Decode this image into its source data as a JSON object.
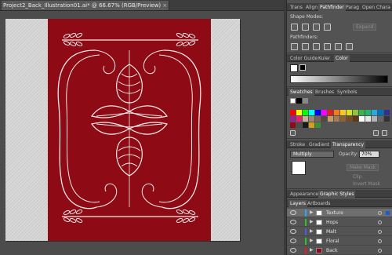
{
  "document": {
    "tab_title": "Project2_Back_Illustration01.ai* @ 66.67% (RGB/Preview)",
    "close_glyph": "×"
  },
  "colors": {
    "red_panel": "#8e0a14",
    "ornament": "#f4e9e9",
    "layer_colors": [
      "#29a8ff",
      "#2fbf2f",
      "#5a55e6",
      "#26c726",
      "#e02020"
    ]
  },
  "dock": {
    "top_tabs": [
      "Trans",
      "Align",
      "Pathfinder",
      "Parag",
      "Open",
      "Chara"
    ],
    "shape_modes_label": "Shape Modes:",
    "expand_label": "Expand",
    "pathfinders_label": "Pathfinders:",
    "color_tabs": [
      "Color Guide",
      "Kuler",
      "Color"
    ],
    "swatch_tabs": [
      "Swatches",
      "Brushes",
      "Symbols"
    ],
    "stroke_tabs": [
      "Stroke",
      "Gradient",
      "Transparency"
    ],
    "blend_mode": "Multiply",
    "opacity_label": "Opacity:",
    "opacity_value": "70%",
    "make_mask_label": "Make Mask",
    "clip_label": "Clip",
    "invert_mask_label": "Invert Mask",
    "appearance_tabs": [
      "Appearance",
      "Graphic Styles"
    ],
    "layers_tabs": [
      "Layers",
      "Artboards"
    ]
  },
  "layers": [
    {
      "name": "Texture",
      "selected": true
    },
    {
      "name": "Hops",
      "selected": false
    },
    {
      "name": "Malt",
      "selected": false
    },
    {
      "name": "Floral",
      "selected": false
    },
    {
      "name": "Back",
      "selected": false
    }
  ]
}
